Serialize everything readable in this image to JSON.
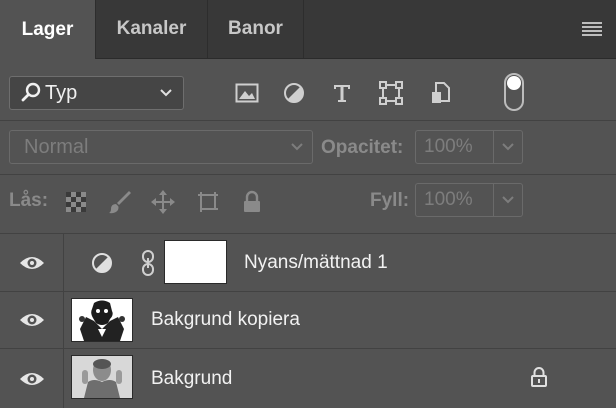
{
  "tabs": [
    {
      "label": "Lager",
      "active": true
    },
    {
      "label": "Kanaler",
      "active": false
    },
    {
      "label": "Banor",
      "active": false
    }
  ],
  "filter": {
    "selected": "Typ",
    "icons": [
      "image-filter-icon",
      "adjustment-filter-icon",
      "type-filter-icon",
      "shape-filter-icon",
      "smart-object-filter-icon"
    ]
  },
  "blend": {
    "mode": "Normal"
  },
  "opacity": {
    "label": "Opacitet:",
    "value": "100%"
  },
  "lock": {
    "label": "Lås:"
  },
  "fill": {
    "label": "Fyll:",
    "value": "100%"
  },
  "layers": [
    {
      "name": "Nyans/mättnad 1",
      "type": "adjustment",
      "visible": true,
      "locked": false
    },
    {
      "name": "Bakgrund kopiera",
      "type": "image",
      "visible": true,
      "locked": false
    },
    {
      "name": "Bakgrund",
      "type": "image",
      "visible": true,
      "locked": true
    }
  ],
  "colors": {
    "panel": "#535353",
    "tabbar": "#383838",
    "text": "#f2f2f2",
    "dim": "#7d7d7d"
  }
}
